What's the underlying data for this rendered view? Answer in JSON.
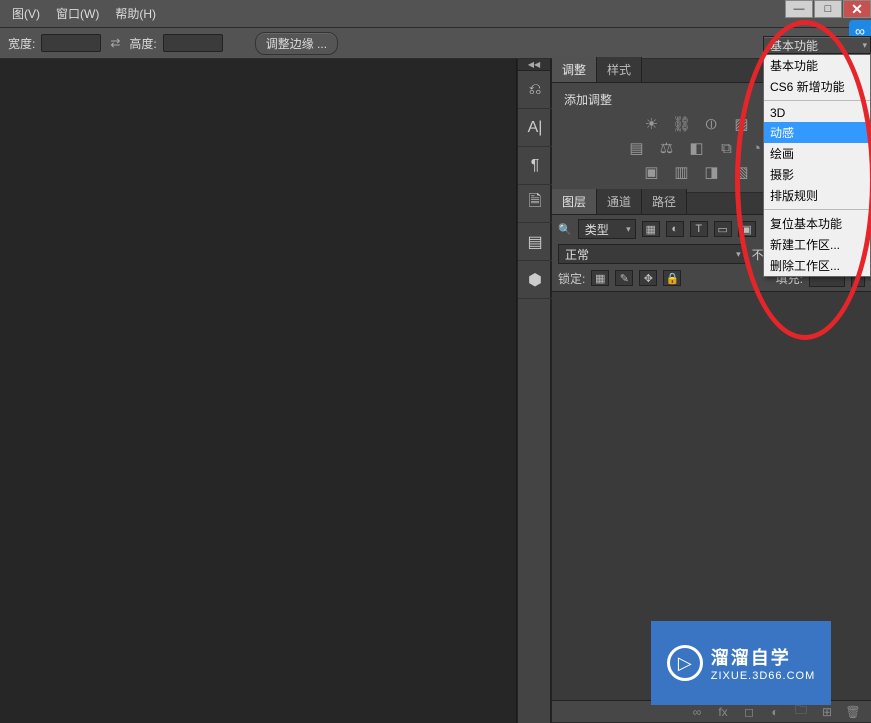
{
  "menu": {
    "view": "图(V)",
    "window": "窗口(W)",
    "help": "帮助(H)"
  },
  "window_controls": {
    "min": "—",
    "max": "□",
    "close": "✕"
  },
  "options": {
    "width_label": "宽度:",
    "height_label": "高度:",
    "swap": "⇄",
    "refine_edges": "调整边缘 ..."
  },
  "workspace": {
    "current": "基本功能",
    "items": [
      "基本功能",
      "CS6 新增功能"
    ],
    "presets": [
      "3D",
      "动感",
      "绘画",
      "摄影",
      "排版规则"
    ],
    "highlight_index": 1,
    "footer": [
      "复位基本功能",
      "新建工作区...",
      "删除工作区..."
    ]
  },
  "adjustments": {
    "tab1": "调整",
    "tab2": "样式",
    "title": "添加调整"
  },
  "layers": {
    "tab1": "图层",
    "tab2": "通道",
    "tab3": "路径",
    "type_label": "类型",
    "blend": "正常",
    "opacity_label": "不透明度:",
    "lock_label": "锁定:",
    "fill_label": "填充:"
  },
  "watermark": {
    "title": "溜溜自学",
    "sub": "ZIXUE.3D66.COM"
  },
  "blue_badge": "∞"
}
